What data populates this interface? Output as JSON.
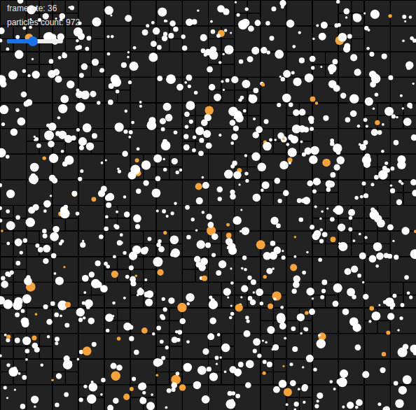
{
  "hud": {
    "framerate": "framerate: 36",
    "particles_count": "particles count: 972"
  },
  "slider": {
    "level": 0.46
  },
  "particle_colors": [
    {
      "kind": "normal",
      "color": "#ffffff",
      "share": 0.92
    },
    {
      "kind": "highlighted",
      "color": "#f7a23b",
      "share": 0.08
    }
  ]
}
